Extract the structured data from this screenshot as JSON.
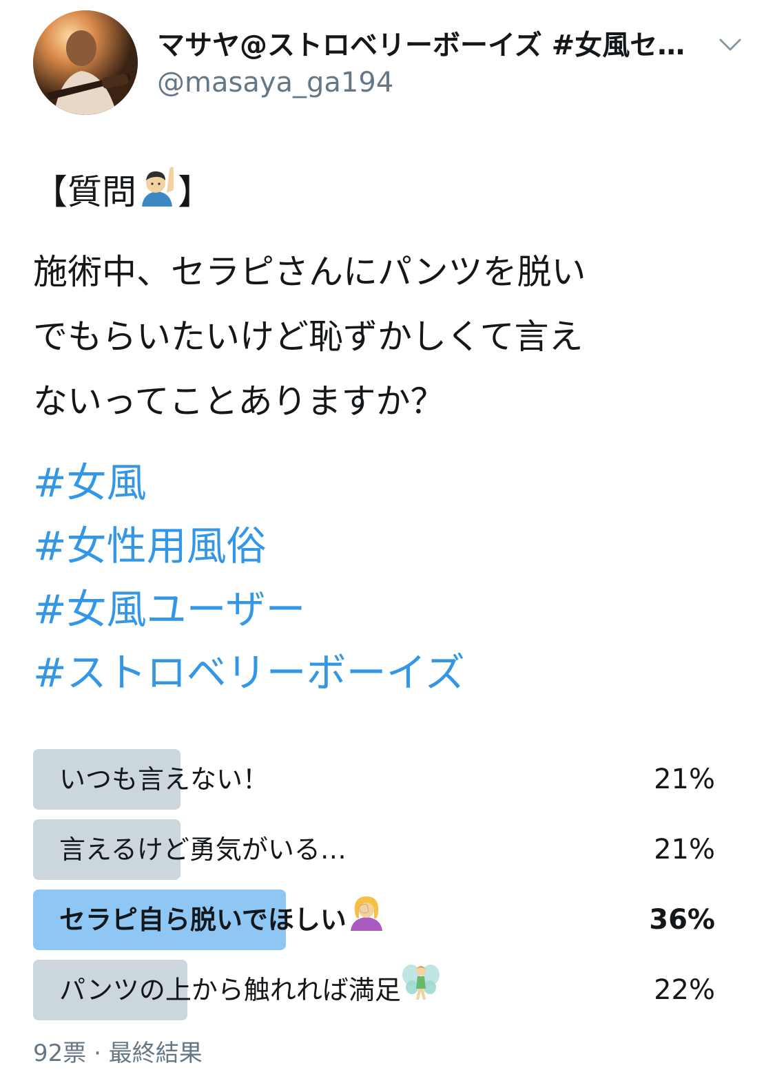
{
  "user": {
    "display_name": "マサヤ@ストロベリーボーイズ #女風セ…",
    "handle": "@masaya_ga194"
  },
  "icons": {
    "avatar": "avatar-photo",
    "caret": "chevron-down-icon",
    "raising-hand": "person-raising-hand-emoji",
    "facepalm": "woman-facepalming-emoji",
    "fairy": "fairy-emoji"
  },
  "tweet": {
    "line1_open": "【質問",
    "line1_close": "】",
    "line2": "施術中、セラピさんにパンツを脱い",
    "line3": "でもらいたいけど恥ずかしくて言え",
    "line4": "ないってことありますか？",
    "hashtags": [
      "#女風",
      "#女性用風俗",
      "#女風ユーザー",
      "#ストロベリーボーイズ"
    ]
  },
  "poll": {
    "options": [
      {
        "label": "いつも言えない！",
        "percent_text": "21%",
        "percent": 21,
        "winner": false
      },
      {
        "label": "言えるけど勇気がいる…",
        "percent_text": "21%",
        "percent": 21,
        "winner": false
      },
      {
        "label": "セラピ自ら脱いでほしい",
        "percent_text": "36%",
        "percent": 36,
        "winner": true
      },
      {
        "label": "パンツの上から触れれば満足",
        "percent_text": "22%",
        "percent": 22,
        "winner": false
      }
    ],
    "votes": "92票",
    "separator": "·",
    "status": "最終結果"
  },
  "colors": {
    "hashtag": "#3497e5",
    "bar": "#ccd6dd",
    "winner_bar": "#8ec7f4",
    "secondary_text": "#657786"
  }
}
